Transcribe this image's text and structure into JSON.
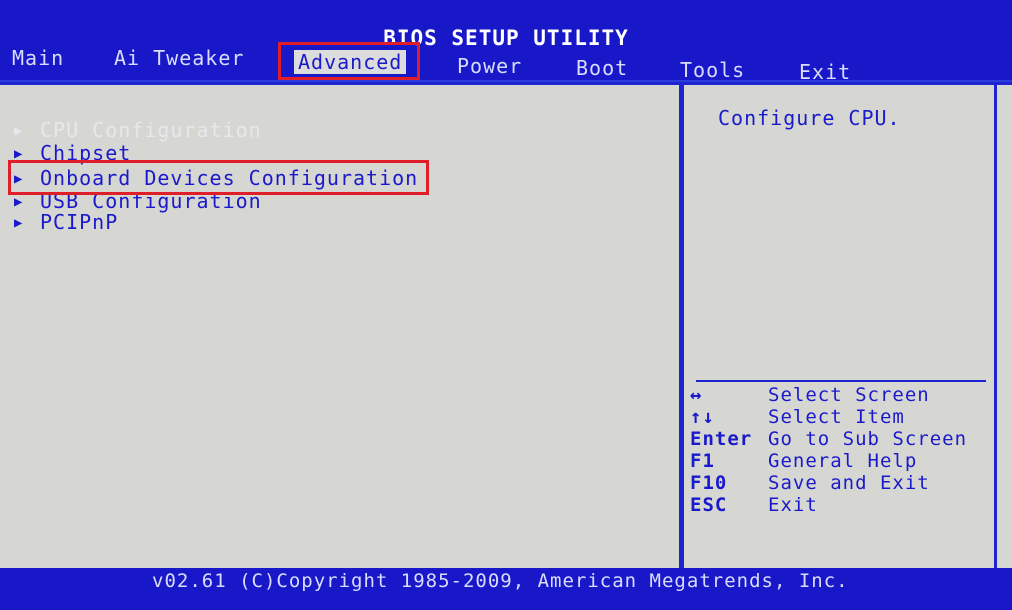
{
  "header": {
    "title": "BIOS SETUP UTILITY"
  },
  "tabs": [
    {
      "label": "Main"
    },
    {
      "label": "Ai Tweaker"
    },
    {
      "label": "Advanced"
    },
    {
      "label": "Power"
    },
    {
      "label": "Boot"
    },
    {
      "label": "Tools"
    },
    {
      "label": "Exit"
    }
  ],
  "menu": {
    "items": [
      {
        "label": "CPU Configuration",
        "arrow": "▶"
      },
      {
        "label": "Chipset",
        "arrow": "▶"
      },
      {
        "label": "Onboard Devices Configuration",
        "arrow": "▶"
      },
      {
        "label": "USB Configuration",
        "arrow": "▶"
      },
      {
        "label": "PCIPnP",
        "arrow": "▶"
      }
    ]
  },
  "help": {
    "text": "Configure CPU."
  },
  "keys": [
    {
      "key": "↔",
      "desc": "Select Screen"
    },
    {
      "key": "↑↓",
      "desc": "Select Item"
    },
    {
      "key": "Enter",
      "desc": "Go to Sub Screen"
    },
    {
      "key": "F1",
      "desc": "General Help"
    },
    {
      "key": "F10",
      "desc": "Save and Exit"
    },
    {
      "key": "ESC",
      "desc": "Exit"
    }
  ],
  "footer": {
    "text": "v02.61 (C)Copyright 1985-2009, American Megatrends, Inc."
  },
  "colors": {
    "bios_blue": "#1818c8",
    "highlight_red": "#e01e2a",
    "panel_gray": "#d6d6d2"
  }
}
